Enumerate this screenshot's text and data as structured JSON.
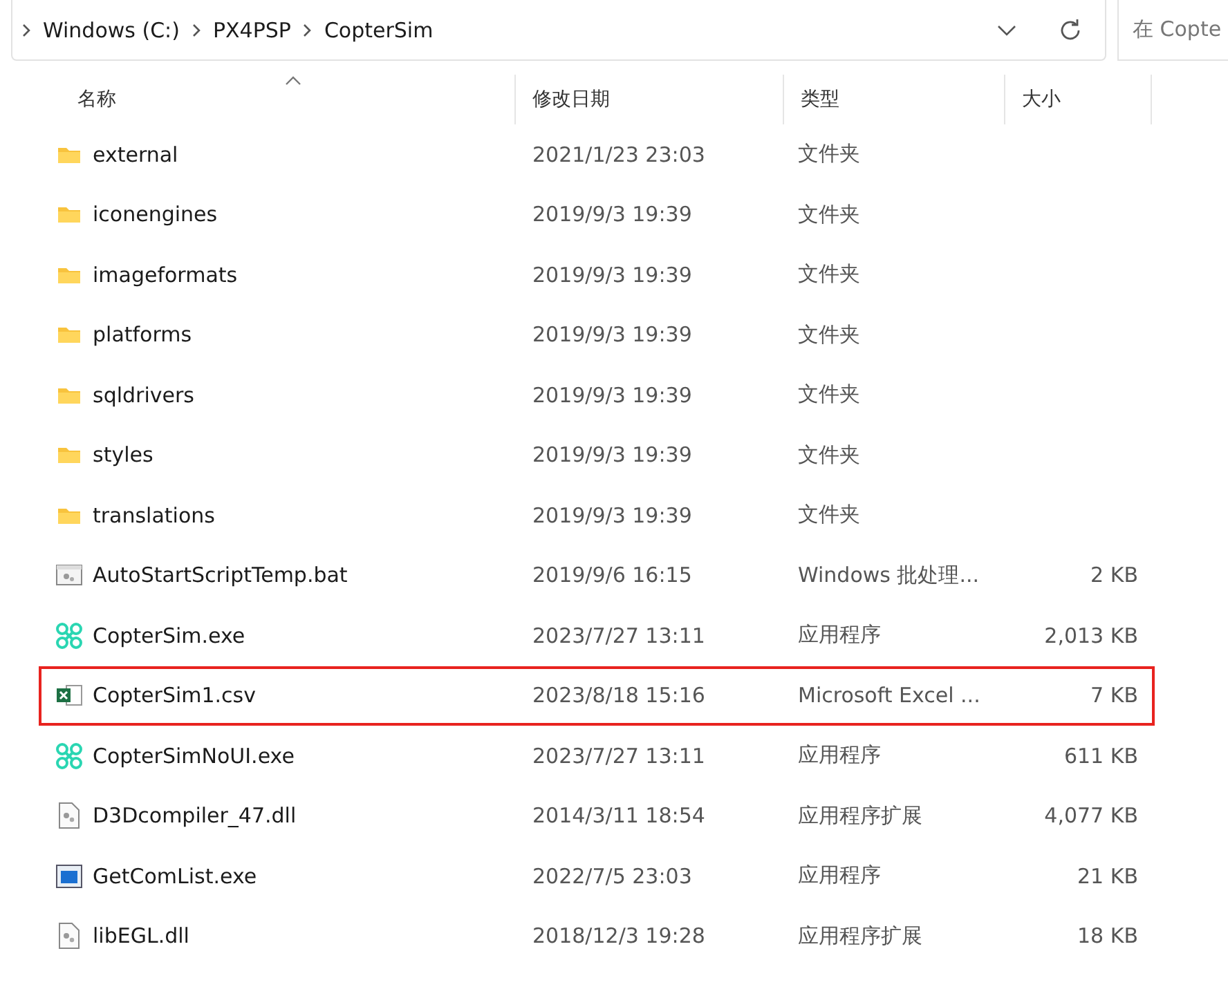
{
  "address_bar": {
    "crumbs": [
      "Windows (C:)",
      "PX4PSP",
      "CopterSim"
    ]
  },
  "search": {
    "placeholder": "在 Copte"
  },
  "table": {
    "columns": [
      {
        "label": "名称",
        "sorted": true
      },
      {
        "label": "修改日期",
        "sorted": false
      },
      {
        "label": "类型",
        "sorted": false
      },
      {
        "label": "大小",
        "sorted": false
      }
    ],
    "rows": [
      {
        "kind": "folder",
        "name": "external",
        "date": "2021/1/23 23:03",
        "type": "文件夹",
        "highlighted": false
      },
      {
        "kind": "folder",
        "name": "iconengines",
        "date": "2019/9/3 19:39",
        "type": "文件夹",
        "highlighted": false
      },
      {
        "kind": "folder",
        "name": "imageformats",
        "date": "2019/9/3 19:39",
        "type": "文件夹",
        "highlighted": false
      },
      {
        "kind": "folder",
        "name": "platforms",
        "date": "2019/9/3 19:39",
        "type": "文件夹",
        "highlighted": false
      },
      {
        "kind": "folder",
        "name": "sqldrivers",
        "date": "2019/9/3 19:39",
        "type": "文件夹",
        "highlighted": false
      },
      {
        "kind": "folder",
        "name": "styles",
        "date": "2019/9/3 19:39",
        "type": "文件夹",
        "highlighted": false
      },
      {
        "kind": "folder",
        "name": "translations",
        "date": "2019/9/3 19:39",
        "type": "文件夹",
        "highlighted": false
      },
      {
        "kind": "script",
        "name": "AutoStartScriptTemp.bat",
        "date": "2019/9/6 16:15",
        "type": "Windows 批处理...",
        "size": "2 KB",
        "highlighted": false
      },
      {
        "kind": "copter",
        "name": "CopterSim.exe",
        "date": "2023/7/27 13:11",
        "type": "应用程序",
        "size": "2,013 KB",
        "highlighted": false
      },
      {
        "kind": "excel",
        "name": "CopterSim1.csv",
        "date": "2023/8/18 15:16",
        "type": "Microsoft Excel ...",
        "size": "7 KB",
        "highlighted": true
      },
      {
        "kind": "copter",
        "name": "CopterSimNoUI.exe",
        "date": "2023/7/27 13:11",
        "type": "应用程序",
        "size": "611 KB",
        "highlighted": false
      },
      {
        "kind": "dll",
        "name": "D3Dcompiler_47.dll",
        "date": "2014/3/11 18:54",
        "type": "应用程序扩展",
        "size": "4,077 KB",
        "highlighted": false
      },
      {
        "kind": "app",
        "name": "GetComList.exe",
        "date": "2022/7/5 23:03",
        "type": "应用程序",
        "size": "21 KB",
        "highlighted": false
      },
      {
        "kind": "dll",
        "name": "libEGL.dll",
        "date": "2018/12/3 19:28",
        "type": "应用程序扩展",
        "size": "18 KB",
        "highlighted": false
      }
    ]
  }
}
